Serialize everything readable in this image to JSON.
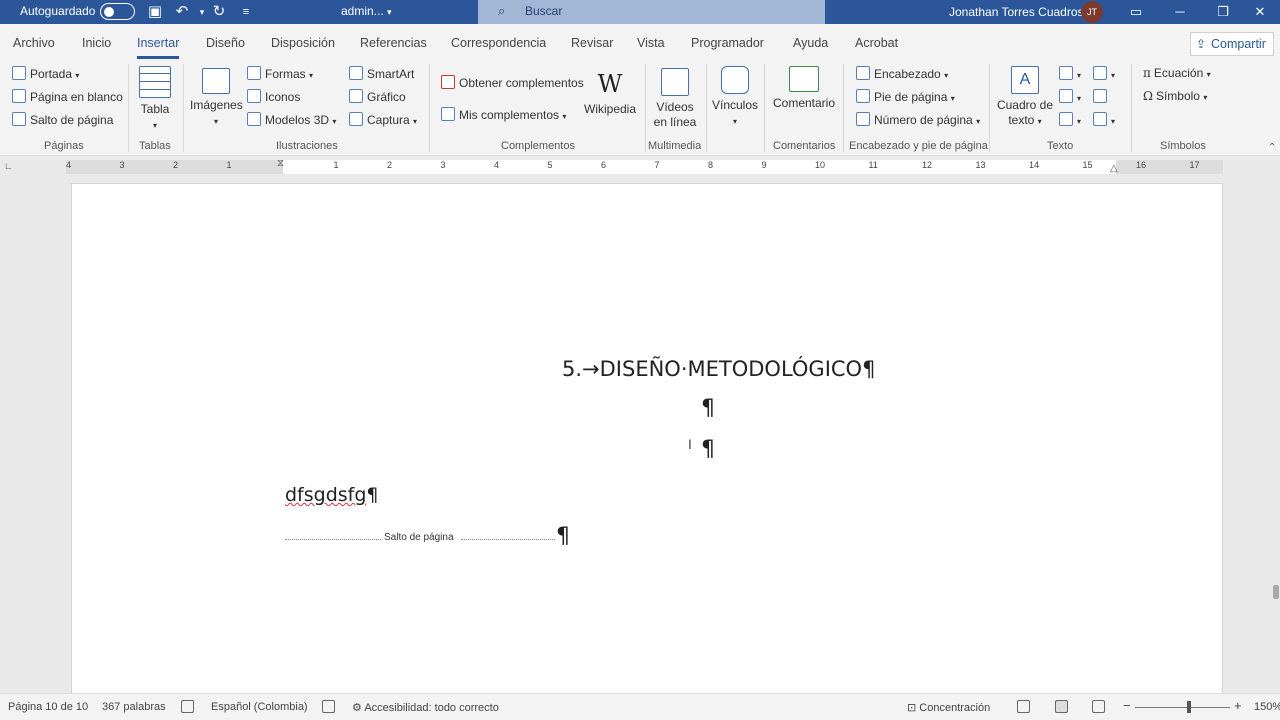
{
  "titlebar": {
    "autosave_label": "Autoguardado",
    "doc_title": "admin...",
    "search_placeholder": "Buscar",
    "user_name": "Jonathan Torres Cuadros",
    "user_initials": "JT"
  },
  "tabs": [
    "Archivo",
    "Inicio",
    "Insertar",
    "Diseño",
    "Disposición",
    "Referencias",
    "Correspondencia",
    "Revisar",
    "Vista",
    "Programador",
    "Ayuda",
    "Acrobat"
  ],
  "active_tab": "Insertar",
  "share_label": "Compartir",
  "ribbon": {
    "paginas": {
      "portada": "Portada",
      "blanco": "Página en blanco",
      "salto": "Salto de página",
      "group": "Páginas"
    },
    "tablas": {
      "tabla": "Tabla",
      "group": "Tablas"
    },
    "ilustraciones": {
      "imagenes": "Imágenes",
      "formas": "Formas",
      "iconos": "Iconos",
      "modelos": "Modelos 3D",
      "smartart": "SmartArt",
      "grafico": "Gráfico",
      "captura": "Captura",
      "group": "Ilustraciones"
    },
    "complementos": {
      "obtener": "Obtener complementos",
      "mis": "Mis complementos",
      "wikipedia": "Wikipedia",
      "group": "Complementos"
    },
    "multimedia": {
      "videos": "Vídeos",
      "videos2": "en línea",
      "group": "Multimedia"
    },
    "vinculos": {
      "label": "Vínculos"
    },
    "comentarios": {
      "comentario": "Comentario",
      "group": "Comentarios"
    },
    "encabezado": {
      "encabezado": "Encabezado",
      "pie": "Pie de página",
      "numero": "Número de página",
      "group": "Encabezado y pie de página"
    },
    "texto": {
      "cuadro": "Cuadro de",
      "cuadro2": "texto",
      "group": "Texto"
    },
    "simbolos": {
      "ecuacion": "Ecuación",
      "simbolo": "Símbolo",
      "group": "Símbolos"
    }
  },
  "ruler_numbers": [
    "4",
    "3",
    "2",
    "1",
    "1",
    "2",
    "3",
    "4",
    "5",
    "6",
    "7",
    "8",
    "9",
    "10",
    "11",
    "12",
    "13",
    "14",
    "15",
    "16",
    "17"
  ],
  "document": {
    "heading": "5.→DISEÑO·METODOLÓGICO¶",
    "pilcrow": "¶",
    "body_text": "dfsgdsfg",
    "page_break_label": "Salto de página"
  },
  "statusbar": {
    "page": "Página 10 de 10",
    "words": "367 palabras",
    "language": "Español (Colombia)",
    "accessibility": "Accesibilidad: todo correcto",
    "focus": "Concentración",
    "zoom": "150%"
  }
}
